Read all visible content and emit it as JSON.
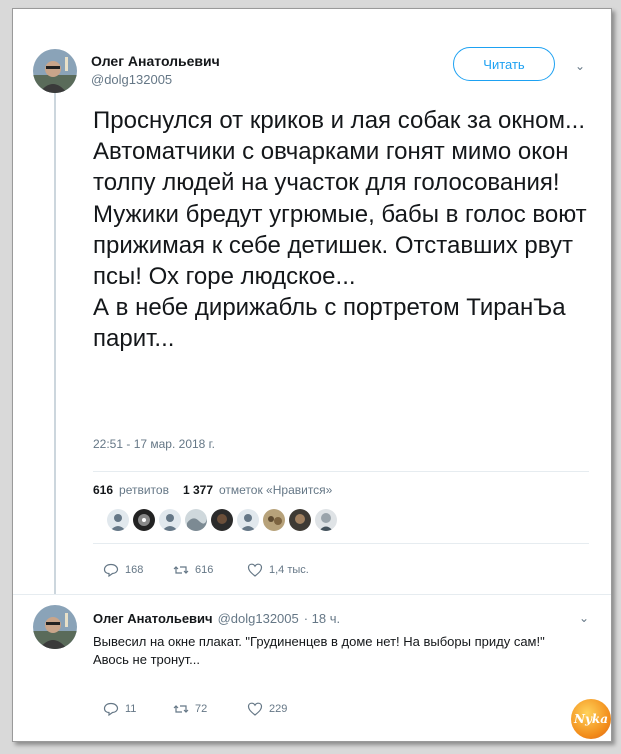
{
  "tweet": {
    "author_name": "Олег Анатольевич",
    "author_handle": "@dolg132005",
    "follow_label": "Читать",
    "text": "Проснулся от криков и лая собак за окном...\nАвтоматчики с овчарками гонят мимо окон толпу людей на участок для голосования! Мужики бредут угрюмые, бабы в голос воют прижимая к себе детишек. Отставших рвут псы! Ох горе людское...\nА в небе дирижабль с портретом ТиранЪа парит...",
    "timestamp": "22:51 - 17 мар. 2018 г.",
    "retweets_count": "616",
    "retweets_label": "ретвитов",
    "likes_count": "1 377",
    "likes_label": "отметок «Нравится»",
    "actions": {
      "replies": "168",
      "retweets": "616",
      "likes": "1,4 тыс."
    }
  },
  "reply": {
    "author_name": "Олег Анатольевич",
    "author_handle": "@dolg132005",
    "time": "· 18 ч.",
    "text": "Вывесил на окне плакат. \"Грудиненцев в доме нет! На выборы приду сам!\"\nАвось не тронут...",
    "actions": {
      "replies": "11",
      "retweets": "72",
      "likes": "229"
    }
  },
  "watermark": {
    "text": "Nyka"
  },
  "icons": {
    "menu": "chevron-down-icon",
    "reply": "reply-icon",
    "retweet": "retweet-icon",
    "like": "heart-icon"
  },
  "colors": {
    "accent": "#1da1f2",
    "muted": "#657786",
    "border": "#e6ecf0"
  }
}
